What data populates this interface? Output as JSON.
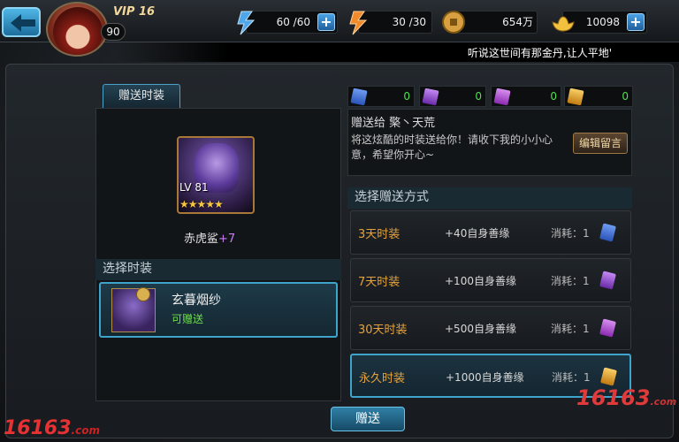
{
  "header": {
    "vip": "VIP 16",
    "level": "90",
    "stamina": "60 /60",
    "vitality": "30 /30",
    "coins": "654万",
    "gold": "10098",
    "ticker": "听说这世间有那金丹,让人平地'"
  },
  "left": {
    "tab": "赠送时装",
    "hero_level": "LV 81",
    "hero_stars": "★★★★★",
    "hero_name": "赤虎鲨",
    "hero_plus": "+7",
    "select_title": "选择时装",
    "item_name": "玄暮烟纱",
    "item_status": "可赠送"
  },
  "right": {
    "counts": [
      "0",
      "0",
      "0",
      "0"
    ],
    "card_colors": [
      "#3a6fe0",
      "#9a48d8",
      "#b14bd6",
      "#e6a22a"
    ],
    "send_to": "赠送给 檠丶天荒",
    "message": "将这炫酷的时装送给你！请收下我的小小心意，希望你开心~",
    "edit_button": "编辑留言",
    "way_title": "选择赠送方式",
    "options": [
      {
        "name": "3天时装",
        "gain": "+40自身善缘",
        "cost": "消耗：1",
        "card": "#3a6fe0"
      },
      {
        "name": "7天时装",
        "gain": "+100自身善缘",
        "cost": "消耗：1",
        "card": "#9a48d8"
      },
      {
        "name": "30天时装",
        "gain": "+500自身善缘",
        "cost": "消耗：1",
        "card": "#b14bd6"
      },
      {
        "name": "永久时装",
        "gain": "+1000自身善缘",
        "cost": "消耗：1",
        "card": "#e6a22a"
      }
    ]
  },
  "footer": {
    "send_button": "赠送",
    "watermark_left": "16163",
    "watermark_left_sub": ".com",
    "watermark_right": "16163",
    "watermark_right_sub": ".com"
  }
}
